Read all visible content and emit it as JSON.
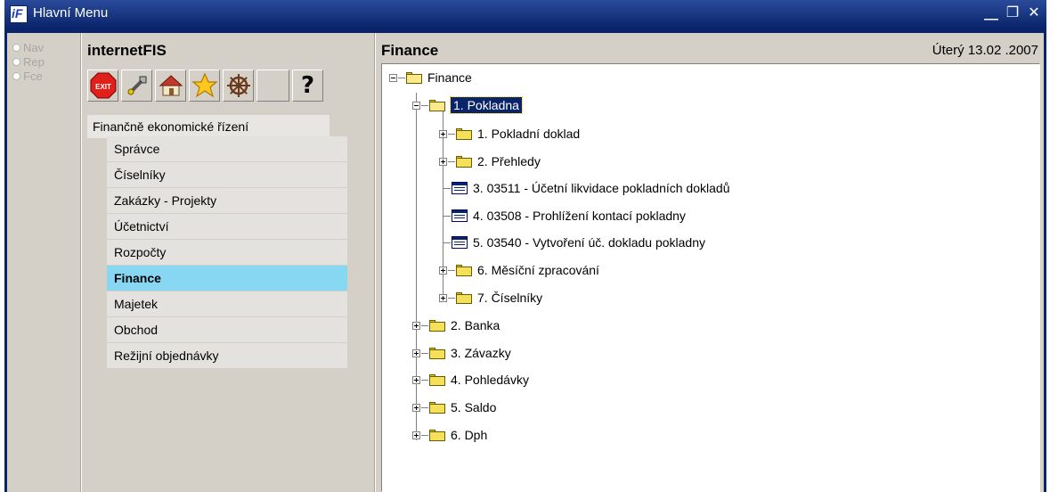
{
  "window": {
    "title": "Hlavní Menu",
    "app_icon_label": "iF",
    "controls": {
      "minimize": "⎽",
      "restore": "❐",
      "close": "✕"
    }
  },
  "mode_radios": [
    {
      "label": "Nav"
    },
    {
      "label": "Rep"
    },
    {
      "label": "Fce"
    }
  ],
  "app_title": "internetFIS",
  "toolbar": {
    "exit": "EXIT",
    "help": "?"
  },
  "section_label": "Finančně ekonomické řízení",
  "menu": [
    {
      "label": "Správce"
    },
    {
      "label": "Číselníky"
    },
    {
      "label": "Zakázky - Projekty"
    },
    {
      "label": "Účetnictví"
    },
    {
      "label": "Rozpočty"
    },
    {
      "label": "Finance",
      "active": true
    },
    {
      "label": "Majetek"
    },
    {
      "label": "Obchod"
    },
    {
      "label": "Režijní objednávky"
    }
  ],
  "panel_title": "Finance",
  "date": "Úterý  13.02 .2007",
  "tree": {
    "root": "Finance",
    "pokladna": "1.  Pokladna",
    "pokladna_children": [
      "1.  Pokladní doklad",
      "2.  Přehledy",
      "3.  03511 - Účetní likvidace pokladních dokladů",
      "4.  03508 - Prohlížení kontací pokladny",
      "5.  03540 - Vytvoření úč. dokladu pokladny",
      "6.  Měsíční zpracování",
      "7.  Číselníky"
    ],
    "top_level": [
      "2.  Banka",
      "3.  Závazky",
      "4.  Pohledávky",
      "5.  Saldo",
      "6.  Dph"
    ]
  },
  "colors": {
    "title_bar": "#0a246a",
    "selected_menu": "#87d7f3",
    "panel_bg": "#d4d0c8"
  }
}
